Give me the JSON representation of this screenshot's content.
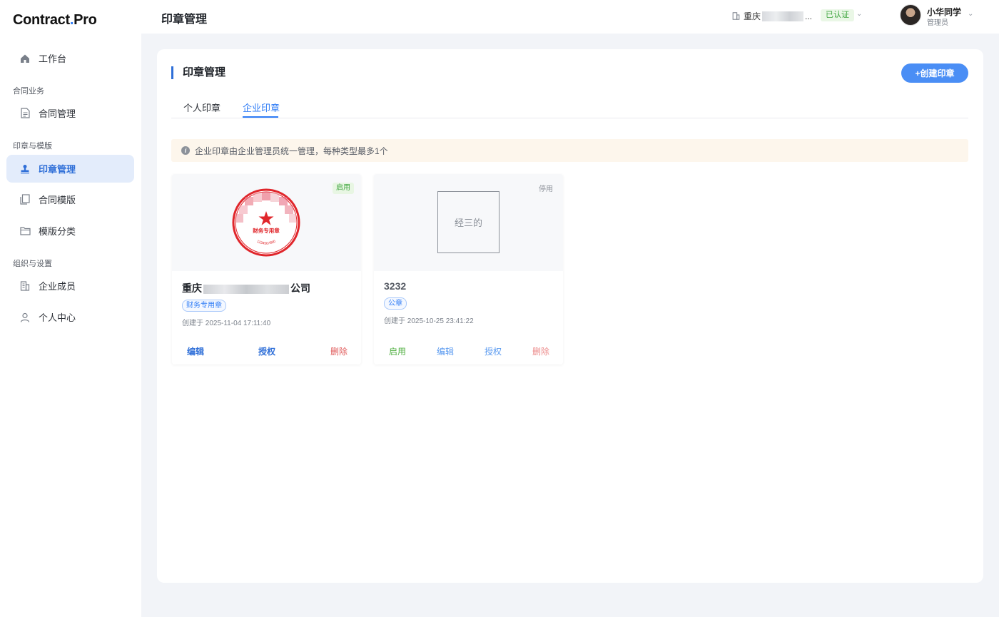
{
  "app": {
    "logo_main": "Contract",
    "logo_dot": ".",
    "logo_suffix": "Pro"
  },
  "sidebar": {
    "workbench": "工作台",
    "group_contract": "合同业务",
    "contract_manage": "合同管理",
    "group_seal": "印章与模版",
    "seal_manage": "印章管理",
    "contract_template": "合同模版",
    "template_category": "模版分类",
    "group_org": "组织与设置",
    "members": "企业成员",
    "personal": "个人中心"
  },
  "header": {
    "page_title": "印章管理",
    "org_prefix": "重庆",
    "org_suffix": "...",
    "verified": "已认证",
    "user_name": "小华同学",
    "user_role": "管理员"
  },
  "panel": {
    "title": "印章管理",
    "create_button": "+创建印章",
    "tabs": [
      "个人印章",
      "企业印章"
    ],
    "notice": "企业印章由企业管理员统一管理，每种类型最多1个"
  },
  "cards": [
    {
      "status": "启用",
      "name_prefix": "重庆",
      "name_suffix": "公司",
      "stamp_center_text": "财务专用章",
      "stamp_serial": "1234567890",
      "type": "财务专用章",
      "created": "创建于 2025-11-04 17:11:40",
      "actions": [
        "编辑",
        "授权",
        "删除"
      ]
    },
    {
      "status": "停用",
      "sign_text": "经三的",
      "name": "3232",
      "type": "公章",
      "created": "创建于 2025-10-25 23:41:22",
      "actions": [
        "启用",
        "编辑",
        "授权",
        "删除"
      ]
    }
  ],
  "colors": {
    "accent": "#2f7cf6",
    "enabled": "#3fa53f",
    "danger": "#e05a5a",
    "stamp_red": "#e0262b"
  }
}
